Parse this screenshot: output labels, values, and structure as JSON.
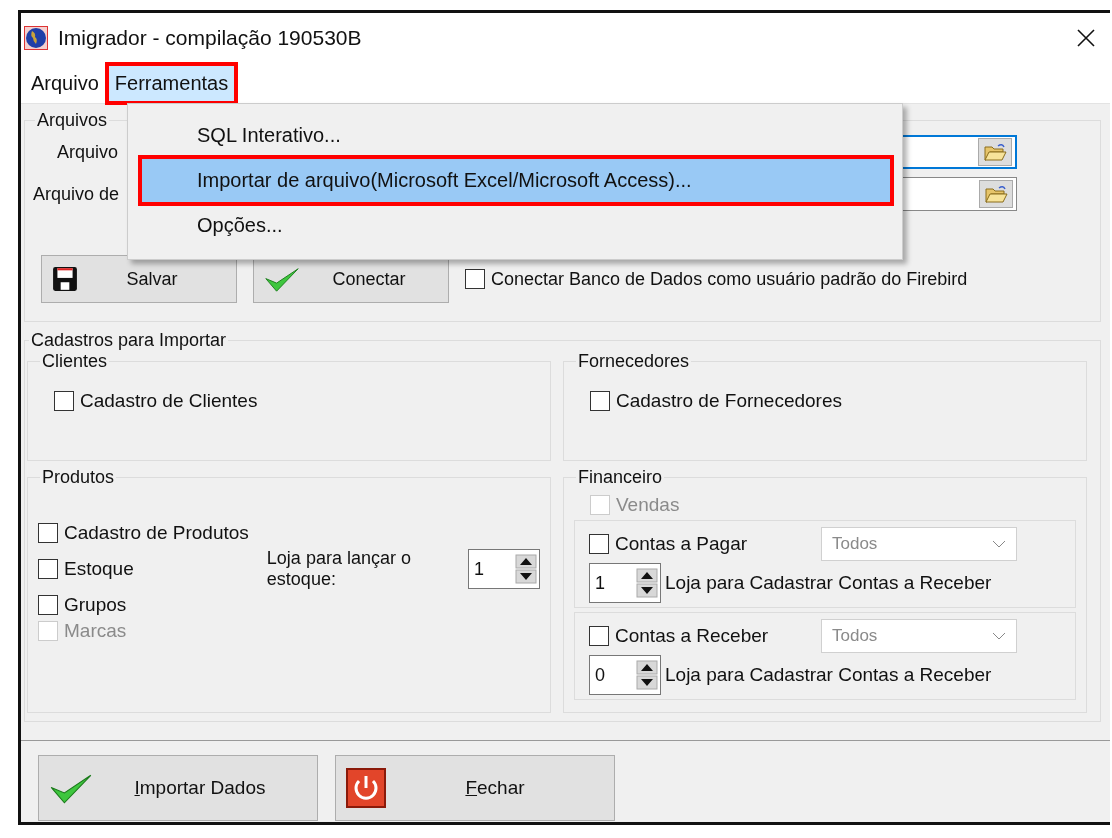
{
  "window": {
    "title": "Imigrador - compilação 190530B"
  },
  "menu_bar": [
    {
      "label": "Arquivo",
      "selected": false,
      "annotated": false
    },
    {
      "label": "Ferramentas",
      "selected": true,
      "annotated": true
    }
  ],
  "dropdown_menu": [
    {
      "label": "SQL Interativo...",
      "selected": false,
      "annotated": false
    },
    {
      "label": "Importar de arquivo(Microsoft Excel/Microsoft Access)...",
      "selected": true,
      "annotated": true
    },
    {
      "label": "Opções...",
      "selected": false,
      "annotated": false
    }
  ],
  "files_group": {
    "title": "Arquivos",
    "fields": [
      {
        "label": "Arquivo",
        "focused": true
      },
      {
        "label": "Arquivo de",
        "focused": false
      }
    ],
    "buttons": [
      {
        "label": "Salvar",
        "kind": "save"
      },
      {
        "label": "Conectar",
        "kind": "check"
      }
    ],
    "default_user": {
      "label": "Conectar Banco de Dados como usuário padrão do Firebird",
      "checked": false
    }
  },
  "import_group": {
    "title": "Cadastros para Importar",
    "panels": [
      {
        "kind": "simple",
        "title": "Clientes",
        "items": [
          {
            "label": "Cadastro de Clientes",
            "checked": false,
            "disabled": false
          }
        ]
      },
      {
        "kind": "simple",
        "title": "Fornecedores",
        "items": [
          {
            "label": "Cadastro de Fornecedores",
            "checked": false,
            "disabled": false
          }
        ]
      },
      {
        "kind": "products",
        "title": "Produtos",
        "items": [
          {
            "label": "Cadastro de Produtos",
            "checked": false,
            "disabled": false
          },
          {
            "label": "Estoque",
            "checked": false,
            "disabled": false
          },
          {
            "label": "Grupos",
            "checked": false,
            "disabled": false
          },
          {
            "label": "Marcas",
            "checked": false,
            "disabled": true
          }
        ],
        "stock_store": {
          "label": "Loja para lançar o estoque:",
          "value": "1"
        }
      },
      {
        "kind": "finance",
        "title": "Financeiro",
        "items": [
          {
            "label": "Vendas",
            "checked": false,
            "disabled": true
          }
        ],
        "accounts": [
          {
            "label": "Contas a Pagar",
            "checked": false,
            "filter": "Todos",
            "store": "1",
            "store_label": "Loja para Cadastrar Contas a Receber"
          },
          {
            "label": "Contas a Receber",
            "checked": false,
            "filter": "Todos",
            "store": "0",
            "store_label": "Loja para Cadastrar Contas a Receber"
          }
        ]
      }
    ]
  },
  "buttons": [
    {
      "label": "Importar Dados",
      "kind": "check"
    },
    {
      "label": "Fechar",
      "kind": "power"
    }
  ]
}
